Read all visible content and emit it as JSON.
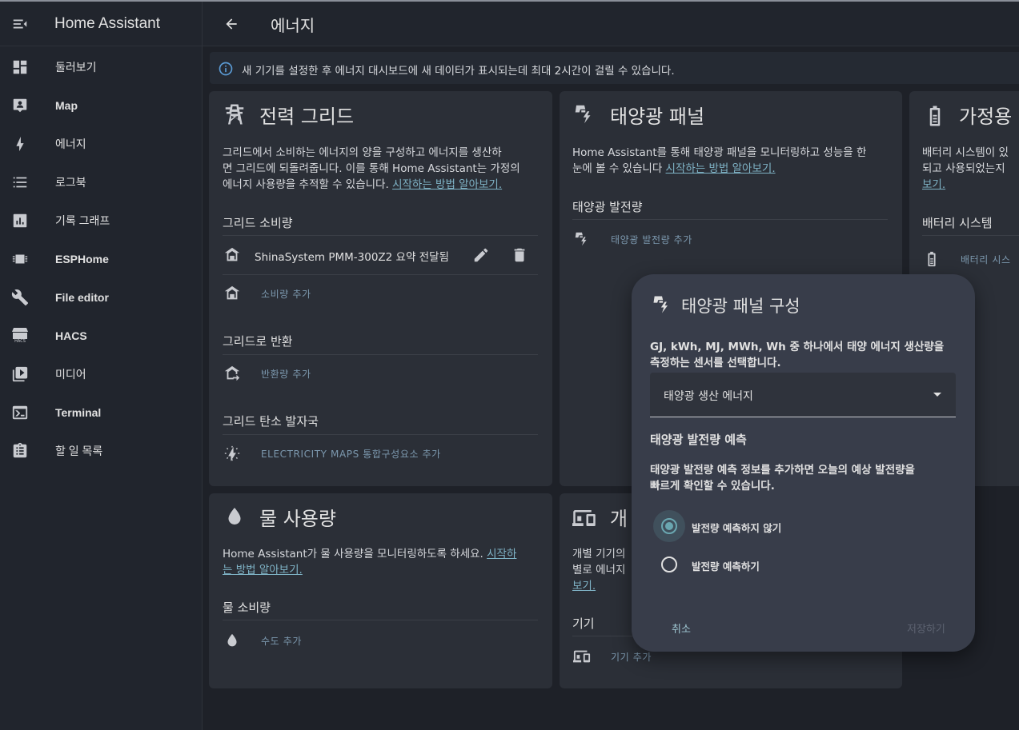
{
  "app": {
    "title": "Home Assistant"
  },
  "sidebar": {
    "items": [
      {
        "label": "둘러보기",
        "icon": "dashboard-icon"
      },
      {
        "label": "Map",
        "icon": "map-account-icon"
      },
      {
        "label": "에너지",
        "icon": "lightning-bolt-icon"
      },
      {
        "label": "로그북",
        "icon": "format-list-bulleted-icon"
      },
      {
        "label": "기록 그래프",
        "icon": "chart-box-icon"
      },
      {
        "label": "ESPHome",
        "icon": "chip-icon"
      },
      {
        "label": "File editor",
        "icon": "wrench-icon"
      },
      {
        "label": "HACS",
        "icon": "hacs-store-icon",
        "icon_text": "HACS"
      },
      {
        "label": "미디어",
        "icon": "play-box-multiple-icon"
      },
      {
        "label": "Terminal",
        "icon": "console-icon"
      },
      {
        "label": "할 일 목록",
        "icon": "clipboard-list-icon"
      }
    ]
  },
  "header": {
    "title": "에너지"
  },
  "banner": {
    "text": "새 기기를 설정한 후 에너지 대시보드에 새 데이터가 표시되는데 최대 2시간이 걸릴 수 있습니다."
  },
  "grid_card": {
    "title": "전력 그리드",
    "desc_line1": "그리드에서 소비하는 에너지의 양을 구성하고 에너지를 생산하",
    "desc_line2": "면 그리드에 되돌려줍니다. 이를 통해 Home Assistant는 가정의",
    "desc_line3": "에너지 사용량을 추적할 수 있습니다.",
    "link": "시작하는 방법 알아보기.",
    "consumption_title": "그리드 소비량",
    "consumption_item": "ShinaSystem PMM-300Z2 요약 전달됨",
    "add_consumption": "소비량 추가",
    "return_title": "그리드로 반환",
    "add_return": "반환량 추가",
    "carbon_title": "그리드 탄소 발자국",
    "add_carbon": "ELECTRICITY MAPS 통합구성요소 추가"
  },
  "solar_card": {
    "title": "태양광 패널",
    "desc_line1": "Home Assistant를 통해 태양광 패널을 모니터링하고 성능을 한",
    "desc_line2": "눈에 볼 수 있습니다",
    "link": "시작하는 방법 알아보기.",
    "production_title": "태양광 발전량",
    "add_production": "태양광 발전량 추가"
  },
  "battery_card": {
    "title": "가정용",
    "desc_line1": "배터리 시스템이 있",
    "desc_line2": "되고 사용되었는지",
    "link_tail": "보기.",
    "system_title": "배터리 시스템",
    "add_battery": "배터리 시스"
  },
  "water_card": {
    "title": "물 사용량",
    "desc_line1": "Home Assistant가 물 사용량을 모니터링하도록 하세요.",
    "link_line1": "시작하",
    "link_line2": "는 방법 알아보기.",
    "consumption_title": "물 소비량",
    "add_water": "수도 추가"
  },
  "device_card": {
    "title": "개",
    "desc_line1": "개별 기기의",
    "desc_line2": "별로 에너지",
    "link_tail": "보기.",
    "devices_title": "기기",
    "add_device": "기기 추가"
  },
  "dialog": {
    "title": "태양광 패널 구성",
    "text_line1": "GJ, kWh, MJ, MWh, Wh 중 하나에서 태양 에너지 생산량을",
    "text_line2": "측정하는 센서를 선택합니다.",
    "select_value": "태양광 생산 에너지",
    "forecast_title": "태양광 발전량 예측",
    "forecast_line1": "태양광 발전량 예측 정보를 추가하면 오늘의 예상 발전량을",
    "forecast_line2": "빠르게 확인할 수 있습니다.",
    "option_no": "발전량 예측하지 않기",
    "option_yes": "발전량 예측하기",
    "cancel": "취소",
    "save": "저장하기"
  },
  "colors": {
    "accent": "#6aa6b0",
    "link": "#7fb3c6",
    "card": "#2b2f37",
    "dialog": "#383d4a"
  }
}
